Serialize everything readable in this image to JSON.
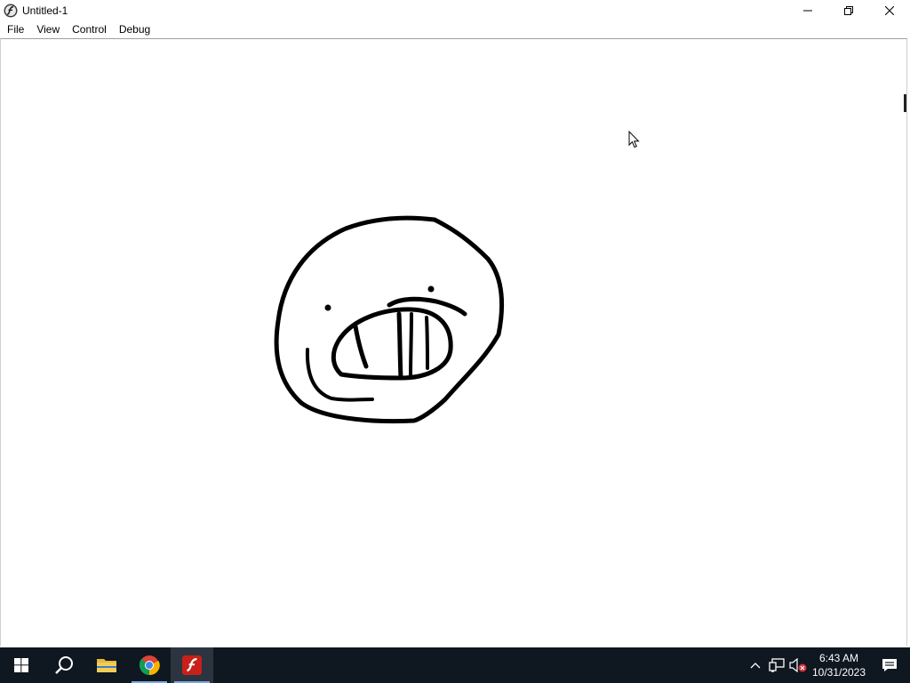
{
  "window": {
    "title": "Untitled-1",
    "app_icon": "flash-player-icon",
    "controls": [
      "minimize-icon",
      "restore-icon",
      "close-icon"
    ]
  },
  "menu": {
    "items": [
      {
        "label": "File"
      },
      {
        "label": "View"
      },
      {
        "label": "Control"
      },
      {
        "label": "Debug"
      }
    ]
  },
  "stage": {
    "background": "#ffffff",
    "drawing": "face-doodle",
    "stroke_color": "#000000"
  },
  "taskbar": {
    "background": "#0f1721",
    "apps": [
      {
        "name": "start-icon"
      },
      {
        "name": "search-icon"
      },
      {
        "name": "file-explorer-icon"
      },
      {
        "name": "chrome-icon",
        "running": true
      },
      {
        "name": "flash-player-icon",
        "running": true,
        "active": true
      }
    ],
    "tray": {
      "icons": [
        "chevron-up-icon",
        "network-icon",
        "volume-muted-icon"
      ],
      "time": "6:43 AM",
      "date": "10/31/2023",
      "notification_icon": "action-center-icon"
    }
  }
}
